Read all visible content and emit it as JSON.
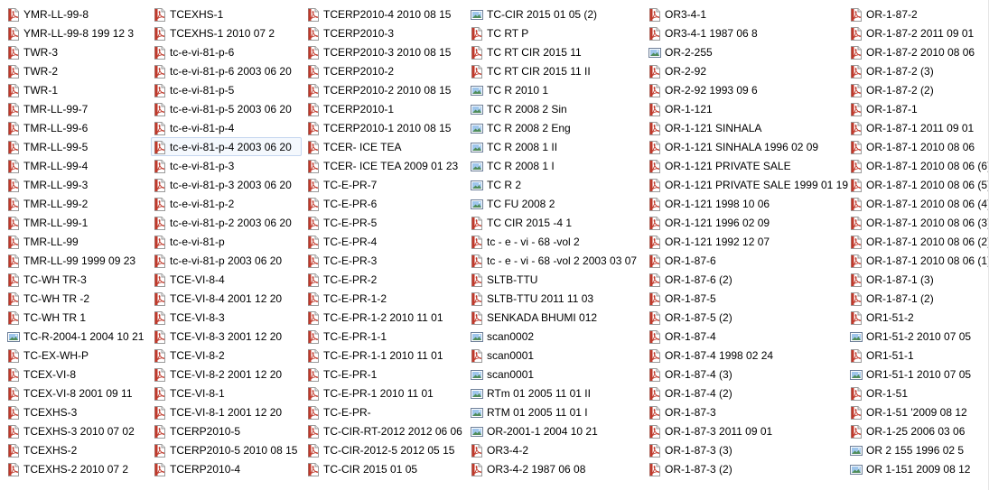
{
  "columns": [
    [
      {
        "label": "YMR-LL-99-8",
        "icon": "pdf-icon"
      },
      {
        "label": "YMR-LL-99-8 199 12 3",
        "icon": "pdf-icon"
      },
      {
        "label": "TWR-3",
        "icon": "pdf-icon"
      },
      {
        "label": "TWR-2",
        "icon": "pdf-icon"
      },
      {
        "label": "TWR-1",
        "icon": "pdf-icon"
      },
      {
        "label": "TMR-LL-99-7",
        "icon": "pdf-icon"
      },
      {
        "label": "TMR-LL-99-6",
        "icon": "pdf-icon"
      },
      {
        "label": "TMR-LL-99-5",
        "icon": "pdf-icon"
      },
      {
        "label": "TMR-LL-99-4",
        "icon": "pdf-icon"
      },
      {
        "label": "TMR-LL-99-3",
        "icon": "pdf-icon"
      },
      {
        "label": "TMR-LL-99-2",
        "icon": "pdf-icon"
      },
      {
        "label": "TMR-LL-99-1",
        "icon": "pdf-icon"
      },
      {
        "label": "TMR-LL-99",
        "icon": "pdf-icon"
      },
      {
        "label": "TMR-LL-99 1999 09 23",
        "icon": "pdf-icon"
      },
      {
        "label": "TC-WH TR-3",
        "icon": "pdf-icon"
      },
      {
        "label": "TC-WH TR -2",
        "icon": "pdf-icon"
      },
      {
        "label": "TC-WH TR 1",
        "icon": "pdf-icon"
      },
      {
        "label": "TC-R-2004-1 2004 10 21",
        "icon": "image-icon"
      },
      {
        "label": "TC-EX-WH-P",
        "icon": "pdf-icon"
      },
      {
        "label": "TCEX-VI-8",
        "icon": "pdf-icon"
      },
      {
        "label": "TCEX-VI-8 2001 09 11",
        "icon": "pdf-icon"
      },
      {
        "label": "TCEXHS-3",
        "icon": "pdf-icon"
      },
      {
        "label": "TCEXHS-3 2010 07 02",
        "icon": "pdf-icon"
      },
      {
        "label": "TCEXHS-2",
        "icon": "pdf-icon"
      },
      {
        "label": "TCEXHS-2 2010 07 2",
        "icon": "pdf-icon"
      }
    ],
    [
      {
        "label": "TCEXHS-1",
        "icon": "pdf-icon"
      },
      {
        "label": "TCEXHS-1 2010 07 2",
        "icon": "pdf-icon"
      },
      {
        "label": "tc-e-vi-81-p-6",
        "icon": "pdf-icon"
      },
      {
        "label": "tc-e-vi-81-p-6 2003 06 20",
        "icon": "pdf-icon"
      },
      {
        "label": "tc-e-vi-81-p-5",
        "icon": "pdf-icon"
      },
      {
        "label": "tc-e-vi-81-p-5 2003 06 20",
        "icon": "pdf-icon"
      },
      {
        "label": "tc-e-vi-81-p-4",
        "icon": "pdf-icon"
      },
      {
        "label": "tc-e-vi-81-p-4 2003 06 20",
        "icon": "pdf-icon",
        "selected": true
      },
      {
        "label": "tc-e-vi-81-p-3",
        "icon": "pdf-icon"
      },
      {
        "label": "tc-e-vi-81-p-3 2003 06 20",
        "icon": "pdf-icon"
      },
      {
        "label": "tc-e-vi-81-p-2",
        "icon": "pdf-icon"
      },
      {
        "label": "tc-e-vi-81-p-2 2003 06 20",
        "icon": "pdf-icon"
      },
      {
        "label": "tc-e-vi-81-p",
        "icon": "pdf-icon"
      },
      {
        "label": "tc-e-vi-81-p 2003 06 20",
        "icon": "pdf-icon"
      },
      {
        "label": "TCE-VI-8-4",
        "icon": "pdf-icon"
      },
      {
        "label": "TCE-VI-8-4 2001 12 20",
        "icon": "pdf-icon"
      },
      {
        "label": "TCE-VI-8-3",
        "icon": "pdf-icon"
      },
      {
        "label": "TCE-VI-8-3 2001 12 20",
        "icon": "pdf-icon"
      },
      {
        "label": "TCE-VI-8-2",
        "icon": "pdf-icon"
      },
      {
        "label": "TCE-VI-8-2 2001 12 20",
        "icon": "pdf-icon"
      },
      {
        "label": "TCE-VI-8-1",
        "icon": "pdf-icon"
      },
      {
        "label": "TCE-VI-8-1 2001 12 20",
        "icon": "pdf-icon"
      },
      {
        "label": "TCERP2010-5",
        "icon": "pdf-icon"
      },
      {
        "label": "TCERP2010-5 2010 08 15",
        "icon": "pdf-icon"
      },
      {
        "label": "TCERP2010-4",
        "icon": "pdf-icon"
      }
    ],
    [
      {
        "label": "TCERP2010-4 2010 08 15",
        "icon": "pdf-icon"
      },
      {
        "label": "TCERP2010-3",
        "icon": "pdf-icon"
      },
      {
        "label": "TCERP2010-3 2010 08 15",
        "icon": "pdf-icon"
      },
      {
        "label": "TCERP2010-2",
        "icon": "pdf-icon"
      },
      {
        "label": "TCERP2010-2 2010 08 15",
        "icon": "pdf-icon"
      },
      {
        "label": "TCERP2010-1",
        "icon": "pdf-icon"
      },
      {
        "label": "TCERP2010-1 2010 08 15",
        "icon": "pdf-icon"
      },
      {
        "label": "TCER- ICE TEA",
        "icon": "pdf-icon"
      },
      {
        "label": "TCER- ICE TEA 2009 01 23",
        "icon": "pdf-icon"
      },
      {
        "label": "TC-E-PR-7",
        "icon": "pdf-icon"
      },
      {
        "label": "TC-E-PR-6",
        "icon": "pdf-icon"
      },
      {
        "label": "TC-E-PR-5",
        "icon": "pdf-icon"
      },
      {
        "label": "TC-E-PR-4",
        "icon": "pdf-icon"
      },
      {
        "label": "TC-E-PR-3",
        "icon": "pdf-icon"
      },
      {
        "label": "TC-E-PR-2",
        "icon": "pdf-icon"
      },
      {
        "label": "TC-E-PR-1-2",
        "icon": "pdf-icon"
      },
      {
        "label": "TC-E-PR-1-2 2010 11 01",
        "icon": "pdf-icon"
      },
      {
        "label": "TC-E-PR-1-1",
        "icon": "pdf-icon"
      },
      {
        "label": "TC-E-PR-1-1 2010 11 01",
        "icon": "pdf-icon"
      },
      {
        "label": "TC-E-PR-1",
        "icon": "pdf-icon"
      },
      {
        "label": "TC-E-PR-1 2010 11 01",
        "icon": "pdf-icon"
      },
      {
        "label": "TC-E-PR-",
        "icon": "pdf-icon"
      },
      {
        "label": "TC-CIR-RT-2012 2012 06 06",
        "icon": "pdf-icon"
      },
      {
        "label": "TC-CIR-2012-5 2012 05 15",
        "icon": "pdf-icon"
      },
      {
        "label": "TC-CIR 2015 01 05",
        "icon": "pdf-icon"
      }
    ],
    [
      {
        "label": "TC-CIR 2015 01 05 (2)",
        "icon": "image-icon"
      },
      {
        "label": "TC RT P",
        "icon": "pdf-icon"
      },
      {
        "label": "TC RT CIR 2015 11",
        "icon": "pdf-icon"
      },
      {
        "label": "TC RT CIR 2015 11 II",
        "icon": "pdf-icon"
      },
      {
        "label": "TC R 2010 1",
        "icon": "image-icon"
      },
      {
        "label": "TC R 2008 2 Sin",
        "icon": "image-icon"
      },
      {
        "label": "TC R 2008 2 Eng",
        "icon": "image-icon"
      },
      {
        "label": "TC R 2008 1 II",
        "icon": "image-icon"
      },
      {
        "label": "TC R 2008 1 I",
        "icon": "image-icon"
      },
      {
        "label": "TC R 2",
        "icon": "image-icon"
      },
      {
        "label": "TC FU 2008 2",
        "icon": "image-icon"
      },
      {
        "label": "TC CIR 2015 -4 1",
        "icon": "pdf-icon"
      },
      {
        "label": "tc - e - vi - 68 -vol 2",
        "icon": "pdf-icon"
      },
      {
        "label": "tc - e - vi - 68 -vol 2 2003 03 07",
        "icon": "pdf-icon"
      },
      {
        "label": "SLTB-TTU",
        "icon": "pdf-icon"
      },
      {
        "label": "SLTB-TTU 2011 11 03",
        "icon": "pdf-icon"
      },
      {
        "label": "SENKADA BHUMI 012",
        "icon": "pdf-icon"
      },
      {
        "label": "scan0002",
        "icon": "image-icon"
      },
      {
        "label": "scan0001",
        "icon": "pdf-icon"
      },
      {
        "label": "scan0001",
        "icon": "image-icon"
      },
      {
        "label": "RTm 01 2005 11 01  II",
        "icon": "image-icon"
      },
      {
        "label": "RTM 01 2005 11 01  I",
        "icon": "image-icon"
      },
      {
        "label": "OR-2001-1 2004 10 21",
        "icon": "image-icon"
      },
      {
        "label": "OR3-4-2",
        "icon": "pdf-icon"
      },
      {
        "label": "OR3-4-2 1987 06 08",
        "icon": "pdf-icon"
      }
    ],
    [
      {
        "label": "OR3-4-1",
        "icon": "pdf-icon"
      },
      {
        "label": "OR3-4-1 1987 06 8",
        "icon": "pdf-icon"
      },
      {
        "label": "OR-2-255",
        "icon": "image-icon"
      },
      {
        "label": "OR-2-92",
        "icon": "pdf-icon"
      },
      {
        "label": "OR-2-92 1993 09 6",
        "icon": "pdf-icon"
      },
      {
        "label": "OR-1-121",
        "icon": "pdf-icon"
      },
      {
        "label": "OR-1-121 SINHALA",
        "icon": "pdf-icon"
      },
      {
        "label": "OR-1-121 SINHALA 1996 02 09",
        "icon": "pdf-icon"
      },
      {
        "label": "OR-1-121 PRIVATE SALE",
        "icon": "pdf-icon"
      },
      {
        "label": "OR-1-121 PRIVATE SALE 1999 01 19",
        "icon": "pdf-icon"
      },
      {
        "label": "OR-1-121 1998 10 06",
        "icon": "pdf-icon"
      },
      {
        "label": "OR-1-121 1996 02 09",
        "icon": "pdf-icon"
      },
      {
        "label": "OR-1-121 1992 12 07",
        "icon": "pdf-icon"
      },
      {
        "label": "OR-1-87-6",
        "icon": "pdf-icon"
      },
      {
        "label": "OR-1-87-6 (2)",
        "icon": "pdf-icon"
      },
      {
        "label": "OR-1-87-5",
        "icon": "pdf-icon"
      },
      {
        "label": "OR-1-87-5 (2)",
        "icon": "pdf-icon"
      },
      {
        "label": "OR-1-87-4",
        "icon": "pdf-icon"
      },
      {
        "label": "OR-1-87-4 1998 02 24",
        "icon": "pdf-icon"
      },
      {
        "label": "OR-1-87-4 (3)",
        "icon": "pdf-icon"
      },
      {
        "label": "OR-1-87-4 (2)",
        "icon": "pdf-icon"
      },
      {
        "label": "OR-1-87-3",
        "icon": "pdf-icon"
      },
      {
        "label": "OR-1-87-3 2011 09 01",
        "icon": "pdf-icon"
      },
      {
        "label": "OR-1-87-3 (3)",
        "icon": "pdf-icon"
      },
      {
        "label": "OR-1-87-3 (2)",
        "icon": "pdf-icon"
      }
    ],
    [
      {
        "label": "OR-1-87-2",
        "icon": "pdf-icon"
      },
      {
        "label": "OR-1-87-2 2011 09 01",
        "icon": "pdf-icon"
      },
      {
        "label": "OR-1-87-2 2010 08 06",
        "icon": "pdf-icon"
      },
      {
        "label": "OR-1-87-2 (3)",
        "icon": "pdf-icon"
      },
      {
        "label": "OR-1-87-2 (2)",
        "icon": "pdf-icon"
      },
      {
        "label": "OR-1-87-1",
        "icon": "pdf-icon"
      },
      {
        "label": "OR-1-87-1 2011 09 01",
        "icon": "pdf-icon"
      },
      {
        "label": "OR-1-87-1 2010 08 06",
        "icon": "pdf-icon"
      },
      {
        "label": "OR-1-87-1 2010 08 06 (6)",
        "icon": "pdf-icon"
      },
      {
        "label": "OR-1-87-1 2010 08 06 (5)",
        "icon": "pdf-icon"
      },
      {
        "label": "OR-1-87-1 2010 08 06 (4)",
        "icon": "pdf-icon"
      },
      {
        "label": "OR-1-87-1 2010 08 06 (3)",
        "icon": "pdf-icon"
      },
      {
        "label": "OR-1-87-1 2010 08 06 (2)",
        "icon": "pdf-icon"
      },
      {
        "label": "OR-1-87-1 2010 08 06 (1)",
        "icon": "pdf-icon"
      },
      {
        "label": "OR-1-87-1 (3)",
        "icon": "pdf-icon"
      },
      {
        "label": "OR-1-87-1 (2)",
        "icon": "pdf-icon"
      },
      {
        "label": "OR1-51-2",
        "icon": "pdf-icon"
      },
      {
        "label": "OR1-51-2 2010 07 05",
        "icon": "image-icon"
      },
      {
        "label": "OR1-51-1",
        "icon": "pdf-icon"
      },
      {
        "label": "OR1-51-1 2010 07 05",
        "icon": "image-icon"
      },
      {
        "label": "OR-1-51",
        "icon": "pdf-icon"
      },
      {
        "label": "OR-1-51 '2009 08 12",
        "icon": "pdf-icon"
      },
      {
        "label": "OR-1-25 2006 03 06",
        "icon": "pdf-icon"
      },
      {
        "label": "OR 2 155 1996 02 5",
        "icon": "image-icon"
      },
      {
        "label": "OR 1-151 2009 08 12",
        "icon": "image-icon"
      }
    ]
  ]
}
